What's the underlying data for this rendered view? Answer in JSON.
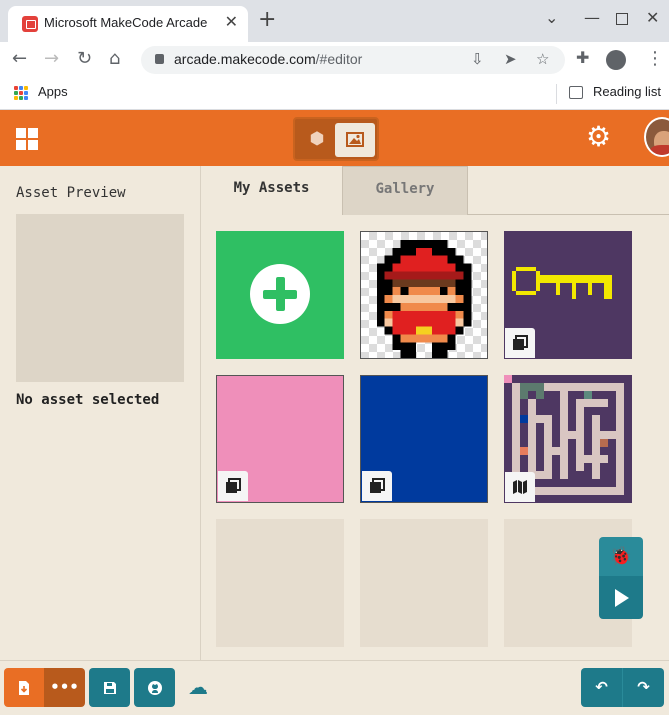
{
  "browser": {
    "tab_title": "Microsoft MakeCode Arcade",
    "url_host": "arcade.makecode.com",
    "url_path": "/#editor",
    "bookmarks": {
      "apps_label": "Apps",
      "reading_list_label": "Reading list"
    }
  },
  "app": {
    "accent": "#e96e24",
    "teal": "#1e7a8a"
  },
  "left_panel": {
    "title": "Asset Preview",
    "empty_message": "No asset selected"
  },
  "tabs": [
    {
      "label": "My Assets",
      "active": true
    },
    {
      "label": "Gallery",
      "active": false
    }
  ],
  "assets": [
    {
      "kind": "new-asset"
    },
    {
      "kind": "sprite",
      "name": "character-sprite"
    },
    {
      "kind": "image",
      "name": "key-image",
      "badge": "image-stack-icon"
    },
    {
      "kind": "image",
      "name": "pink-image",
      "badge": "image-stack-icon",
      "color": "#ef8fba"
    },
    {
      "kind": "image",
      "name": "blue-image",
      "badge": "image-stack-icon",
      "color": "#003a9e"
    },
    {
      "kind": "tilemap",
      "name": "maze-tilemap",
      "badge": "map-icon"
    },
    {
      "kind": "empty"
    },
    {
      "kind": "empty"
    },
    {
      "kind": "empty"
    }
  ]
}
